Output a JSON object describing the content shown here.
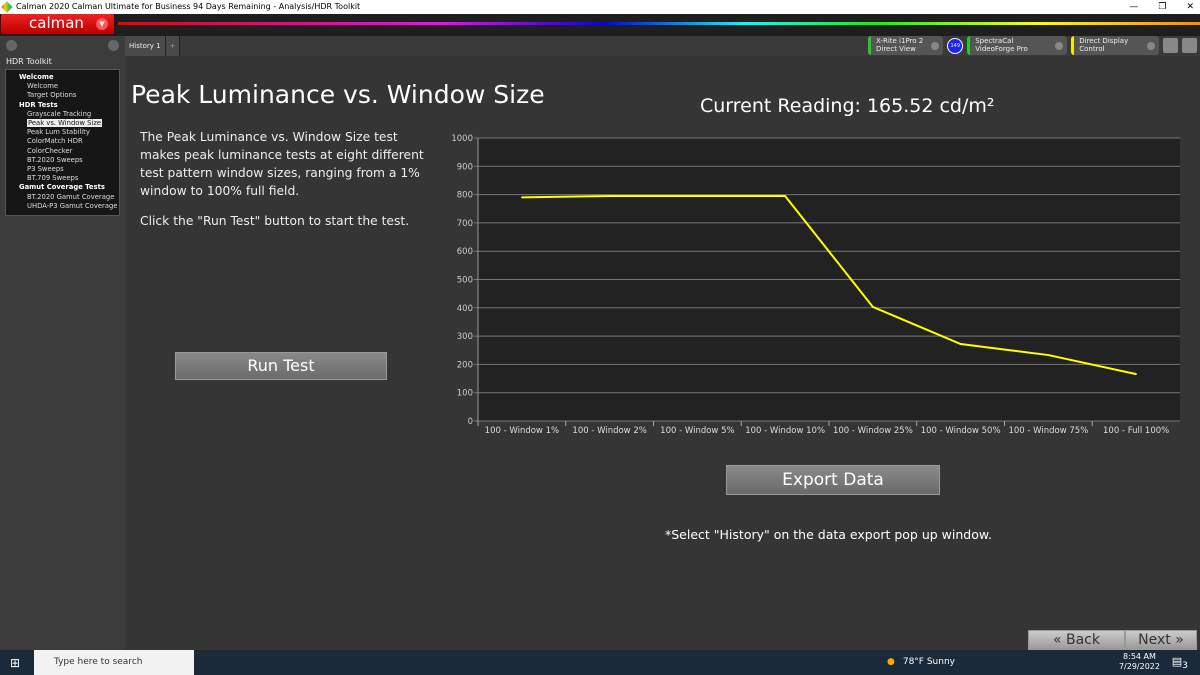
{
  "window": {
    "title": "Calman 2020 Calman Ultimate for Business 94 Days Remaining - Analysis/HDR Toolkit"
  },
  "logo": "calman",
  "sidebar": {
    "title": "HDR Toolkit",
    "items": [
      {
        "label": "Welcome",
        "group": true
      },
      {
        "label": "Welcome"
      },
      {
        "label": "Target Options"
      },
      {
        "label": "HDR Tests",
        "group": true
      },
      {
        "label": "Grayscale Tracking"
      },
      {
        "label": "Peak vs. Window Size",
        "selected": true
      },
      {
        "label": "Peak Lum Stability"
      },
      {
        "label": "ColorMatch HDR"
      },
      {
        "label": "ColorChecker"
      },
      {
        "label": "BT.2020 Sweeps"
      },
      {
        "label": "P3 Sweeps"
      },
      {
        "label": "BT.709 Sweeps"
      },
      {
        "label": "Gamut Coverage Tests",
        "group": true
      },
      {
        "label": "BT.2020 Gamut Coverage"
      },
      {
        "label": "UHDA-P3 Gamut Coverage"
      }
    ]
  },
  "tabs": [
    {
      "label": "History 1"
    },
    {
      "label": "+"
    }
  ],
  "devices": {
    "meter": "X-Rite i1Pro 2",
    "meter_mode": "Direct View",
    "badge": "149",
    "source": "SpectraCal VideoForge Pro",
    "display": "Direct Display Control"
  },
  "main": {
    "title": "Peak Luminance vs. Window Size",
    "reading": "Current Reading: 165.52 cd/m²",
    "desc1": "The Peak Luminance vs. Window Size test makes peak luminance tests at eight different test pattern window sizes, ranging from a 1% window to 100% full field.",
    "desc2": "Click the \"Run Test\" button to start the test.",
    "run_label": "Run Test",
    "export_label": "Export  Data",
    "note": "*Select \"History\" on the data export pop up window.",
    "back_label": "Back",
    "next_label": "Next"
  },
  "chart_data": {
    "type": "line",
    "categories": [
      "100 - Window  1%",
      "100 - Window  2%",
      "100 - Window  5%",
      "100 - Window 10%",
      "100 - Window 25%",
      "100 - Window 50%",
      "100 - Window 75%",
      "100 - Full  100%"
    ],
    "values": [
      790,
      795,
      795,
      795,
      403,
      272,
      233,
      165.52
    ],
    "ylim": [
      0,
      1000
    ],
    "yticks": [
      0,
      100,
      200,
      300,
      400,
      500,
      600,
      700,
      800,
      900,
      1000
    ],
    "grid": true,
    "line_color": "#ffff00"
  },
  "taskbar": {
    "search_placeholder": "Type here to search",
    "weather": "78°F  Sunny",
    "time": "8:54 AM",
    "date": "7/29/2022",
    "notifications": "3"
  }
}
